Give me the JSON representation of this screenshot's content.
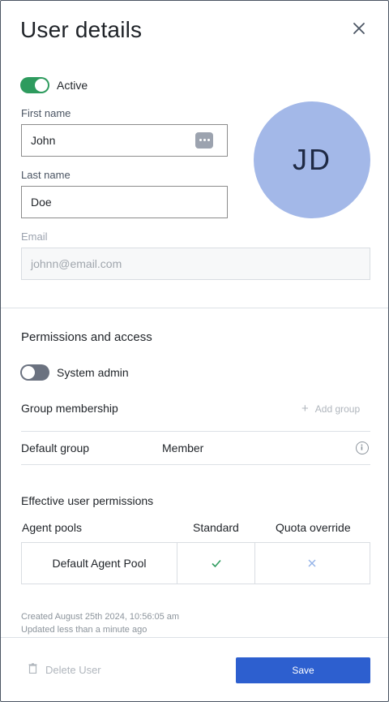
{
  "header": {
    "title": "User details",
    "close_icon": "close-icon"
  },
  "profile": {
    "active_toggle": {
      "label": "Active",
      "on": true
    },
    "first_name": {
      "label": "First name",
      "value": "John"
    },
    "last_name": {
      "label": "Last name",
      "value": "Doe"
    },
    "email": {
      "label": "Email",
      "placeholder": "johnn@email.com"
    },
    "avatar_initials": "JD",
    "password_manager_icon": "password-manager-icon"
  },
  "permissions": {
    "title": "Permissions and access",
    "system_admin_toggle": {
      "label": "System admin",
      "on": false
    },
    "group_membership": {
      "title": "Group membership",
      "add_label": "Add group",
      "rows": [
        {
          "group": "Default group",
          "role": "Member"
        }
      ]
    },
    "effective": {
      "title": "Effective user permissions",
      "columns": [
        "Agent pools",
        "Standard",
        "Quota override"
      ],
      "rows": [
        {
          "pool": "Default Agent Pool",
          "standard": true,
          "quota_override": false
        }
      ]
    }
  },
  "meta": {
    "created": "Created August 25th 2024, 10:56:05 am",
    "updated": "Updated less than a minute ago"
  },
  "footer": {
    "delete_label": "Delete User",
    "save_label": "Save"
  },
  "colors": {
    "accent": "#2d5fcf",
    "active_green": "#2e9b5e",
    "avatar_bg": "#a3b8e8"
  }
}
